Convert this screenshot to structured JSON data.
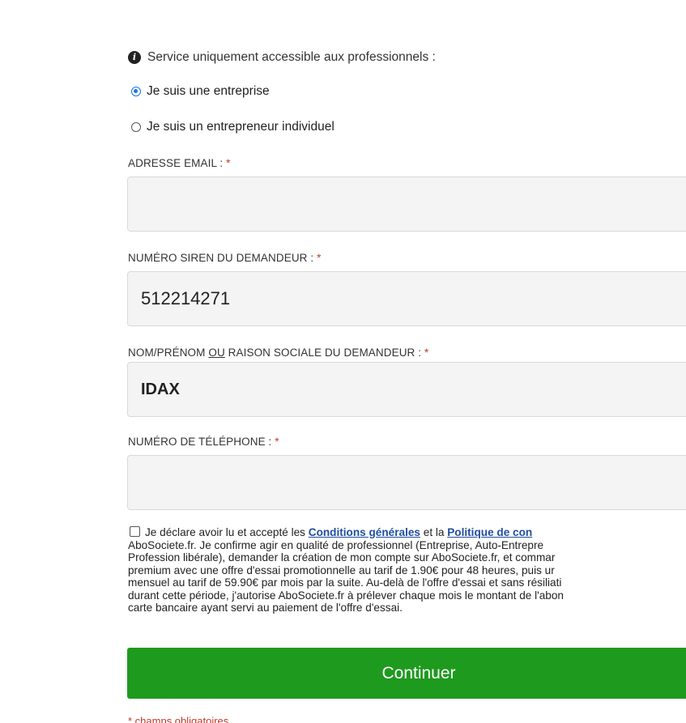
{
  "info": {
    "icon": "info-circle-icon",
    "text": "Service uniquement accessible aux professionnels :"
  },
  "radios": [
    {
      "label": "Je suis une entreprise",
      "checked": true
    },
    {
      "label": "Je suis un entrepreneur individuel",
      "checked": false
    }
  ],
  "fields": {
    "email": {
      "label": "ADRESSE EMAIL : ",
      "required": "*",
      "value": ""
    },
    "siren": {
      "label": "NUMÉRO SIREN DU DEMANDEUR : ",
      "required": "*",
      "value": "512214271"
    },
    "name": {
      "label_pre": "NOM/PRÉNOM ",
      "label_ou": "OU",
      "label_post": " RAISON SOCIALE DU DEMANDEUR : ",
      "required": "*",
      "value": "IDAX"
    },
    "phone": {
      "label": "NUMÉRO DE TÉLÉPHONE : ",
      "required": "*",
      "value": ""
    }
  },
  "terms": {
    "l1a": "Je déclare avoir lu et accepté les ",
    "cgu_link": "Conditions générales",
    "l1b": " et la ",
    "policy_link": "Politique de con",
    "l2": "AboSociete.fr. Je confirme agir en qualité de professionnel (Entreprise, Auto-Entrepre",
    "l3": "Profession libérale), demander la création de mon compte sur AboSociete.fr, et commar",
    "l4": "premium avec une offre d'essai promotionnelle au tarif de 1.90€ pour 48 heures, puis ur",
    "l5": "mensuel au tarif de 59.90€ par mois par la suite. Au-delà de l'offre d'essai et sans résiliati",
    "l6": "durant cette période, j'autorise AboSociete.fr à prélever chaque mois le montant de l'abon",
    "l7": "carte bancaire ayant servi au paiement de l'offre d'essai."
  },
  "continue_label": "Continuer",
  "footnote": "* champs obligatoires",
  "colors": {
    "button": "#1e9a1e",
    "link": "#1f4e9e",
    "required": "#c0392b",
    "radio": "#1a73e8"
  }
}
